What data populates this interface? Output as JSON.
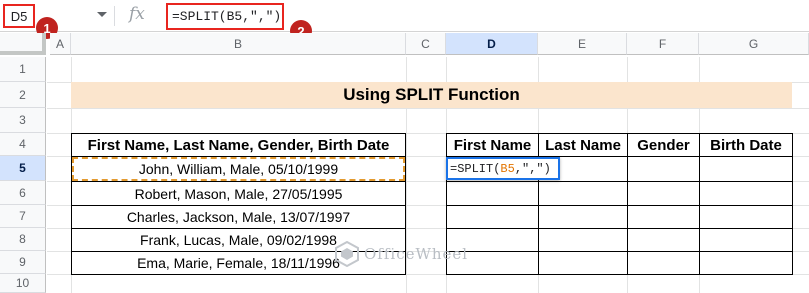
{
  "formula_bar": {
    "name_box": "D5",
    "fx": "fx",
    "formula_prefix": "=SPLIT(",
    "formula_ref": "B5",
    "formula_suffix": ",\",\")"
  },
  "badges": [
    "1",
    "2"
  ],
  "columns": [
    "A",
    "B",
    "C",
    "D",
    "E",
    "F",
    "G"
  ],
  "rows": [
    "1",
    "2",
    "3",
    "4",
    "5",
    "6",
    "7",
    "8",
    "9",
    "10"
  ],
  "selected": {
    "column": "D",
    "row": "5"
  },
  "title": "Using SPLIT Function",
  "source_table": {
    "header": "First Name, Last Name, Gender, Birth Date",
    "rows": [
      "John, William, Male, 05/10/1999",
      "Robert, Mason, Male, 27/05/1995",
      "Charles, Jackson, Male, 13/07/1997",
      "Frank, Lucas, Male, 09/02/1998",
      "Ema, Marie, Female, 18/11/1996"
    ]
  },
  "split_table": {
    "headers": [
      "First Name",
      "Last Name",
      "Gender",
      "Birth Date"
    ]
  },
  "cell_editor": {
    "prefix": "=SPLIT(",
    "ref": "B5",
    "suffix": ",\",\")"
  },
  "watermark": "OfficeWheel",
  "colors": {
    "accent_red": "#e8251f",
    "title_fill": "#fbe5cd",
    "selection_blue": "#1a73e8",
    "ref_orange": "#e37400"
  }
}
